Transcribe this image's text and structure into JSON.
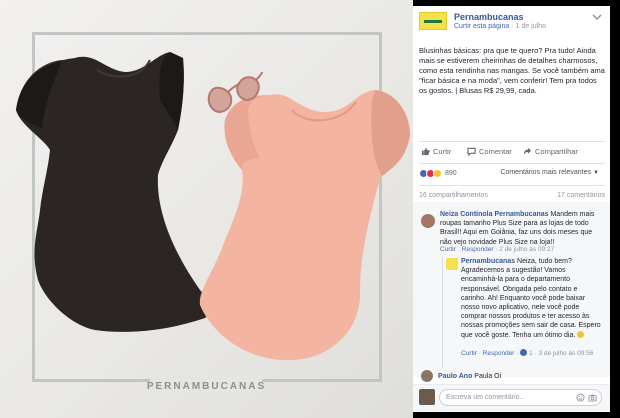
{
  "photo": {
    "watermark": "PERNAMBUCANAS",
    "colors": {
      "black_shirt": "#2b2624",
      "pink_shirt": "#f3b4a1",
      "frame": "#c3c4c4",
      "glasses": "#c98d82"
    }
  },
  "post": {
    "page_name": "Pernambucanas",
    "page_sub": {
      "action": "Curtir esta página",
      "date": "1 de julho"
    },
    "body": "Blusinhas básicas: pra que te quero? Pra tudo! Ainda mais se estiverem cheirinhas de detalhes charmosos, como esta rendinha nas mangas. Se você também ama \"ficar básica e na moda\", vem conferir! Tem pra todos os gostos. | Blusas R$ 29,99, cada.",
    "actions": {
      "like": "Curtir",
      "comment": "Comentar",
      "share": "Compartilhar"
    },
    "reactions": {
      "count": "890",
      "sort_label": "Comentários mais relevantes"
    },
    "shares": "16 compartilhamentos",
    "comment_count": "17 comentários",
    "comments": [
      {
        "name": "Neiza Continola Pernambucanas",
        "text": " Mandem mais roupas tamanho Plus Size para as lojas de todo Brasil!! Aqui em Goiânia, faz uns dois meses que não vejo novidade Plus Size na loja!!",
        "meta": {
          "like": "Curtir",
          "reply": "Responder",
          "time": "2 de julho às 09:27"
        }
      },
      {
        "name": "Pernambucanas",
        "text": " Neiza, tudo bem? Agradecemos a sugestão! Vamos encaminhá-la para o departamento responsável. Obrigada pelo contato e carinho. Ah! Enquanto você pode baixar nosso novo aplicativo, nele você pode comprar nossos produtos e ter acesso às nossas promoções sem sair de casa. Espero que você goste. Tenha um ótimo dia.",
        "meta": {
          "like": "Curtir",
          "reply": "Responder",
          "likes": "1",
          "time": "3 de julho às 09:56"
        }
      },
      {
        "name": "Paulo Ano",
        "text": " Paula Oi"
      }
    ],
    "write_placeholder": "Escreva um comentário..."
  }
}
